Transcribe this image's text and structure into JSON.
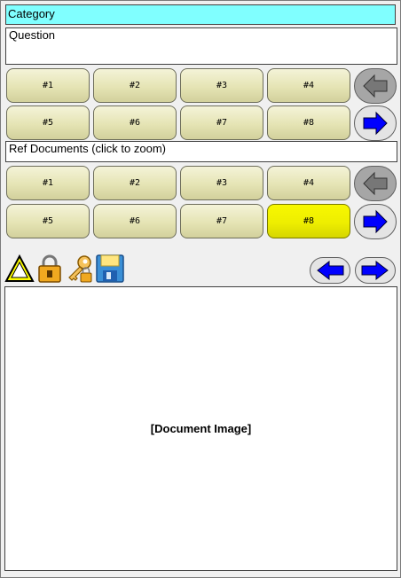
{
  "category": {
    "label": "Category"
  },
  "question": {
    "label": "Question"
  },
  "answers": {
    "buttons": [
      "#1",
      "#2",
      "#3",
      "#4",
      "#5",
      "#6",
      "#7",
      "#8"
    ],
    "selected": null
  },
  "ref_documents": {
    "label": "Ref Documents (click to zoom)",
    "buttons": [
      "#1",
      "#2",
      "#3",
      "#4",
      "#5",
      "#6",
      "#7",
      "#8"
    ],
    "selected": "#8"
  },
  "document": {
    "placeholder": "[Document Image]"
  },
  "toolbar": {
    "icons": [
      "warning-icon",
      "lock-icon",
      "key-icon",
      "save-icon"
    ]
  },
  "colors": {
    "category_bg": "#80ffff",
    "button_bg": "#e5e4b4",
    "button_selected_bg": "#eeee00",
    "arrow_active": "#0000ff",
    "arrow_disabled": "#777777"
  }
}
